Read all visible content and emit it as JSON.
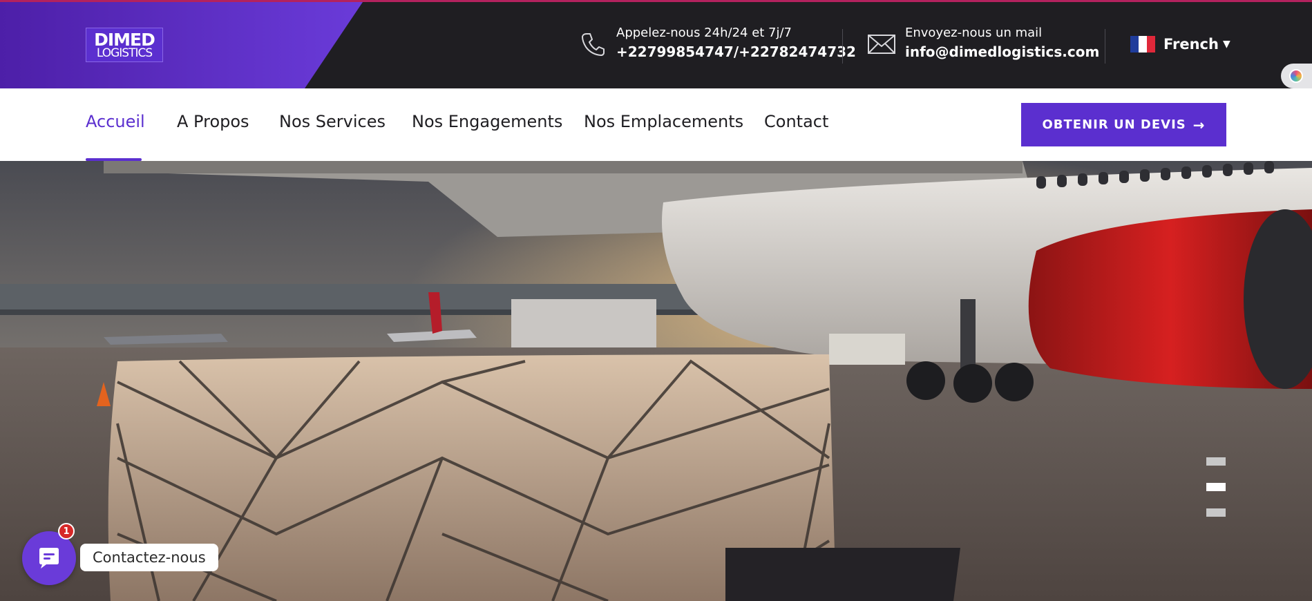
{
  "brand": {
    "logo_line1": "DIMED",
    "logo_line2": "LOGISTICS"
  },
  "header": {
    "phone": {
      "label": "Appelez-nous 24h/24 et 7j/7",
      "value": "+22799854747/+22782474732",
      "icon": "phone-icon"
    },
    "email": {
      "label": "Envoyez-nous un mail",
      "value": "info@dimedlogistics.com",
      "icon": "mail-icon"
    },
    "language": {
      "label": "French",
      "flag": "france-flag-icon"
    }
  },
  "nav": {
    "items": [
      {
        "label": "Accueil",
        "active": true
      },
      {
        "label": "A Propos"
      },
      {
        "label": "Nos Services"
      },
      {
        "label": "Nos Engagements"
      },
      {
        "label": "Nos Emplacements"
      },
      {
        "label": "Contact"
      }
    ],
    "cta_label": "OBTENIR UN DEVIS"
  },
  "hero": {
    "slides": 3,
    "active_slide": 2
  },
  "chat": {
    "label": "Contactez-nous",
    "badge": "1"
  },
  "colors": {
    "brand_purple": "#5b2fcf",
    "topbar_dark": "#1f1e22",
    "accent_line": "#b3225e",
    "badge_red": "#d62828"
  }
}
